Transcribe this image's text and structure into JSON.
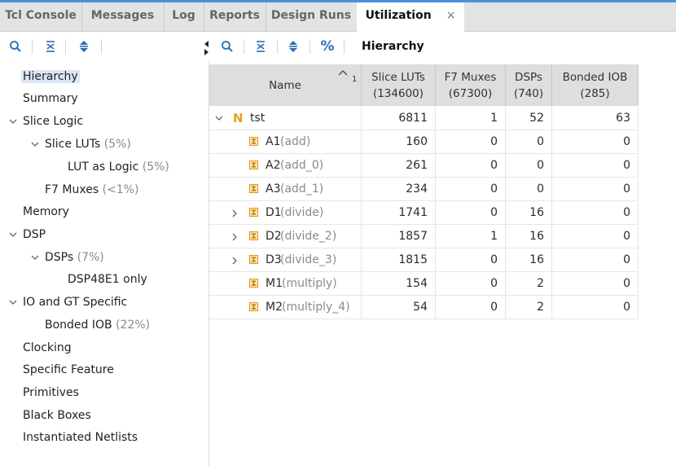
{
  "tabs": [
    {
      "label": "Tcl Console"
    },
    {
      "label": "Messages"
    },
    {
      "label": "Log"
    },
    {
      "label": "Reports"
    },
    {
      "label": "Design Runs"
    },
    {
      "label": "Utilization",
      "close": "×"
    }
  ],
  "toolbar": {
    "percent_label": "%",
    "hierarchy_label": "Hierarchy"
  },
  "tree": [
    {
      "label": "Hierarchy",
      "pct": ""
    },
    {
      "label": "Summary",
      "pct": ""
    },
    {
      "label": "Slice Logic",
      "pct": ""
    },
    {
      "label": "Slice LUTs",
      "pct": " (5%)"
    },
    {
      "label": "LUT as Logic",
      "pct": " (5%)"
    },
    {
      "label": "F7 Muxes",
      "pct": " (<1%)"
    },
    {
      "label": "Memory",
      "pct": ""
    },
    {
      "label": "DSP",
      "pct": ""
    },
    {
      "label": "DSPs",
      "pct": " (7%)"
    },
    {
      "label": "DSP48E1 only",
      "pct": ""
    },
    {
      "label": "IO and GT Specific",
      "pct": ""
    },
    {
      "label": "Bonded IOB",
      "pct": " (22%)"
    },
    {
      "label": "Clocking",
      "pct": ""
    },
    {
      "label": "Specific Feature",
      "pct": ""
    },
    {
      "label": "Primitives",
      "pct": ""
    },
    {
      "label": "Black Boxes",
      "pct": ""
    },
    {
      "label": "Instantiated Netlists",
      "pct": ""
    }
  ],
  "table": {
    "headers": {
      "name": "Name",
      "sort_index": "1",
      "slice_luts": "Slice LUTs",
      "slice_luts_avail": "(134600)",
      "f7_muxes": "F7 Muxes",
      "f7_muxes_avail": "(67300)",
      "dsps": "DSPs",
      "dsps_avail": "(740)",
      "bonded_iob": "Bonded IOB",
      "bonded_iob_avail": "(285)"
    },
    "rows": [
      {
        "name": "tst",
        "inst": "",
        "luts": "6811",
        "f7": "1",
        "dsps": "52",
        "iob": "63"
      },
      {
        "name": "A1",
        "inst": " (add)",
        "luts": "160",
        "f7": "0",
        "dsps": "0",
        "iob": "0"
      },
      {
        "name": "A2",
        "inst": " (add_0)",
        "luts": "261",
        "f7": "0",
        "dsps": "0",
        "iob": "0"
      },
      {
        "name": "A3",
        "inst": " (add_1)",
        "luts": "234",
        "f7": "0",
        "dsps": "0",
        "iob": "0"
      },
      {
        "name": "D1",
        "inst": " (divide)",
        "luts": "1741",
        "f7": "0",
        "dsps": "16",
        "iob": "0"
      },
      {
        "name": "D2",
        "inst": " (divide_2)",
        "luts": "1857",
        "f7": "1",
        "dsps": "16",
        "iob": "0"
      },
      {
        "name": "D3",
        "inst": " (divide_3)",
        "luts": "1815",
        "f7": "0",
        "dsps": "16",
        "iob": "0"
      },
      {
        "name": "M1",
        "inst": " (multiply)",
        "luts": "154",
        "f7": "0",
        "dsps": "2",
        "iob": "0"
      },
      {
        "name": "M2",
        "inst": " (multiply_4)",
        "luts": "54",
        "f7": "0",
        "dsps": "2",
        "iob": "0"
      }
    ]
  },
  "colors": {
    "accent": "#4a90d9",
    "module_icon": "#e8a317",
    "selected_bg": "#dbe6f5"
  }
}
